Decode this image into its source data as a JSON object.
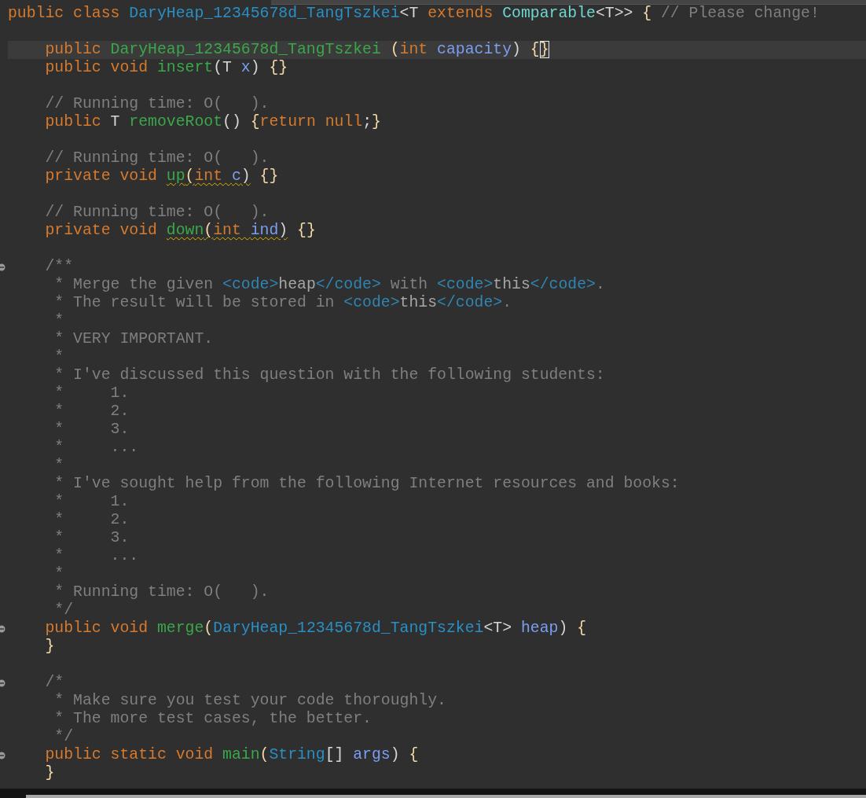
{
  "lines": [
    {
      "fold": false,
      "current": false,
      "tokens": [
        {
          "text": "public class ",
          "kind": "keyword",
          "warning": false,
          "cursor": false
        },
        {
          "text": "DaryHeap_12345678d_TangTszkei",
          "kind": "class",
          "warning": false,
          "cursor": false
        },
        {
          "text": "<T ",
          "kind": "plain",
          "warning": false,
          "cursor": false
        },
        {
          "text": "extends ",
          "kind": "keyword",
          "warning": false,
          "cursor": false
        },
        {
          "text": "Comparable",
          "kind": "type",
          "warning": false,
          "cursor": false
        },
        {
          "text": "<T>> ",
          "kind": "plain",
          "warning": false,
          "cursor": false
        },
        {
          "text": "{ ",
          "kind": "brace",
          "warning": false,
          "cursor": false
        },
        {
          "text": "// Please change!",
          "kind": "comment",
          "warning": false,
          "cursor": false
        }
      ]
    },
    {
      "fold": false,
      "current": false
    },
    {
      "fold": false,
      "current": true,
      "tokens": [
        {
          "text": "    public ",
          "kind": "keyword",
          "warning": false,
          "cursor": false
        },
        {
          "text": "DaryHeap_12345678d_TangTszkei ",
          "kind": "method",
          "warning": false,
          "cursor": false
        },
        {
          "text": "(",
          "kind": "brace",
          "warning": false,
          "cursor": false
        },
        {
          "text": "int ",
          "kind": "keyword",
          "warning": false,
          "cursor": false
        },
        {
          "text": "capacity",
          "kind": "param",
          "warning": false,
          "cursor": false
        },
        {
          "text": ") ",
          "kind": "plain",
          "warning": false,
          "cursor": false
        },
        {
          "text": "{",
          "kind": "brace",
          "warning": false,
          "cursor": false
        },
        {
          "text": "}",
          "kind": "brace",
          "warning": false,
          "cursor": true
        }
      ]
    },
    {
      "fold": false,
      "current": false,
      "tokens": [
        {
          "text": "    public void ",
          "kind": "keyword",
          "warning": false,
          "cursor": false
        },
        {
          "text": "insert",
          "kind": "method",
          "warning": false,
          "cursor": false
        },
        {
          "text": "(T ",
          "kind": "plain",
          "warning": false,
          "cursor": false
        },
        {
          "text": "x",
          "kind": "param",
          "warning": false,
          "cursor": false
        },
        {
          "text": ") ",
          "kind": "plain",
          "warning": false,
          "cursor": false
        },
        {
          "text": "{}",
          "kind": "brace",
          "warning": false,
          "cursor": false
        }
      ]
    },
    {
      "fold": false,
      "current": false
    },
    {
      "fold": false,
      "current": false,
      "tokens": [
        {
          "text": "    // Running time: O(   ).",
          "kind": "comment",
          "warning": false,
          "cursor": false
        }
      ]
    },
    {
      "fold": false,
      "current": false,
      "tokens": [
        {
          "text": "    public ",
          "kind": "keyword",
          "warning": false,
          "cursor": false
        },
        {
          "text": "T ",
          "kind": "plain",
          "warning": false,
          "cursor": false
        },
        {
          "text": "removeRoot",
          "kind": "method",
          "warning": false,
          "cursor": false
        },
        {
          "text": "() ",
          "kind": "plain",
          "warning": false,
          "cursor": false
        },
        {
          "text": "{",
          "kind": "brace",
          "warning": false,
          "cursor": false
        },
        {
          "text": "return null",
          "kind": "keyword",
          "warning": false,
          "cursor": false
        },
        {
          "text": ";",
          "kind": "plain",
          "warning": false,
          "cursor": false
        },
        {
          "text": "}",
          "kind": "brace",
          "warning": false,
          "cursor": false
        }
      ]
    },
    {
      "fold": false,
      "current": false
    },
    {
      "fold": false,
      "current": false,
      "tokens": [
        {
          "text": "    // Running time: O(   ).",
          "kind": "comment",
          "warning": false,
          "cursor": false
        }
      ]
    },
    {
      "fold": false,
      "current": false,
      "tokens": [
        {
          "text": "    private void ",
          "kind": "keyword",
          "warning": false,
          "cursor": false
        },
        {
          "text": "up",
          "kind": "method",
          "warning": true,
          "cursor": false
        },
        {
          "text": "(",
          "kind": "brace",
          "warning": true,
          "cursor": false
        },
        {
          "text": "int ",
          "kind": "keyword",
          "warning": true,
          "cursor": false
        },
        {
          "text": "c",
          "kind": "param",
          "warning": true,
          "cursor": false
        },
        {
          "text": ")",
          "kind": "plain",
          "warning": true,
          "cursor": false
        },
        {
          "text": " {}",
          "kind": "brace",
          "warning": false,
          "cursor": false
        }
      ]
    },
    {
      "fold": false,
      "current": false
    },
    {
      "fold": false,
      "current": false,
      "tokens": [
        {
          "text": "    // Running time: O(   ).",
          "kind": "comment",
          "warning": false,
          "cursor": false
        }
      ]
    },
    {
      "fold": false,
      "current": false,
      "tokens": [
        {
          "text": "    private void ",
          "kind": "keyword",
          "warning": false,
          "cursor": false
        },
        {
          "text": "down",
          "kind": "method",
          "warning": true,
          "cursor": false
        },
        {
          "text": "(",
          "kind": "brace",
          "warning": true,
          "cursor": false
        },
        {
          "text": "int ",
          "kind": "keyword",
          "warning": true,
          "cursor": false
        },
        {
          "text": "ind",
          "kind": "param",
          "warning": true,
          "cursor": false
        },
        {
          "text": ")",
          "kind": "plain",
          "warning": true,
          "cursor": false
        },
        {
          "text": " {}",
          "kind": "brace",
          "warning": false,
          "cursor": false
        }
      ]
    },
    {
      "fold": false,
      "current": false
    },
    {
      "fold": true,
      "current": false,
      "tokens": [
        {
          "text": "    /**",
          "kind": "comment",
          "warning": false,
          "cursor": false
        }
      ]
    },
    {
      "fold": false,
      "current": false,
      "tokens": [
        {
          "text": "     * Merge the given ",
          "kind": "comment",
          "warning": false,
          "cursor": false
        },
        {
          "text": "<code>",
          "kind": "tag",
          "warning": false,
          "cursor": false
        },
        {
          "text": "heap",
          "kind": "doctext",
          "warning": false,
          "cursor": false
        },
        {
          "text": "</code>",
          "kind": "tag",
          "warning": false,
          "cursor": false
        },
        {
          "text": " with ",
          "kind": "comment",
          "warning": false,
          "cursor": false
        },
        {
          "text": "<code>",
          "kind": "tag",
          "warning": false,
          "cursor": false
        },
        {
          "text": "this",
          "kind": "doctext",
          "warning": false,
          "cursor": false
        },
        {
          "text": "</code>",
          "kind": "tag",
          "warning": false,
          "cursor": false
        },
        {
          "text": ".",
          "kind": "comment",
          "warning": false,
          "cursor": false
        }
      ]
    },
    {
      "fold": false,
      "current": false,
      "tokens": [
        {
          "text": "     * The result will be stored in ",
          "kind": "comment",
          "warning": false,
          "cursor": false
        },
        {
          "text": "<code>",
          "kind": "tag",
          "warning": false,
          "cursor": false
        },
        {
          "text": "this",
          "kind": "doctext",
          "warning": false,
          "cursor": false
        },
        {
          "text": "</code>",
          "kind": "tag",
          "warning": false,
          "cursor": false
        },
        {
          "text": ".",
          "kind": "comment",
          "warning": false,
          "cursor": false
        }
      ]
    },
    {
      "fold": false,
      "current": false,
      "tokens": [
        {
          "text": "     *",
          "kind": "comment",
          "warning": false,
          "cursor": false
        }
      ]
    },
    {
      "fold": false,
      "current": false,
      "tokens": [
        {
          "text": "     * VERY IMPORTANT.",
          "kind": "comment",
          "warning": false,
          "cursor": false
        }
      ]
    },
    {
      "fold": false,
      "current": false,
      "tokens": [
        {
          "text": "     *",
          "kind": "comment",
          "warning": false,
          "cursor": false
        }
      ]
    },
    {
      "fold": false,
      "current": false,
      "tokens": [
        {
          "text": "     * I've discussed this question with the following students:",
          "kind": "comment",
          "warning": false,
          "cursor": false
        }
      ]
    },
    {
      "fold": false,
      "current": false,
      "tokens": [
        {
          "text": "     *     1.",
          "kind": "comment",
          "warning": false,
          "cursor": false
        }
      ]
    },
    {
      "fold": false,
      "current": false,
      "tokens": [
        {
          "text": "     *     2.",
          "kind": "comment",
          "warning": false,
          "cursor": false
        }
      ]
    },
    {
      "fold": false,
      "current": false,
      "tokens": [
        {
          "text": "     *     3.",
          "kind": "comment",
          "warning": false,
          "cursor": false
        }
      ]
    },
    {
      "fold": false,
      "current": false,
      "tokens": [
        {
          "text": "     *     ...",
          "kind": "comment",
          "warning": false,
          "cursor": false
        }
      ]
    },
    {
      "fold": false,
      "current": false,
      "tokens": [
        {
          "text": "     *",
          "kind": "comment",
          "warning": false,
          "cursor": false
        }
      ]
    },
    {
      "fold": false,
      "current": false,
      "tokens": [
        {
          "text": "     * I've sought help from the following Internet resources and books:",
          "kind": "comment",
          "warning": false,
          "cursor": false
        }
      ]
    },
    {
      "fold": false,
      "current": false,
      "tokens": [
        {
          "text": "     *     1.",
          "kind": "comment",
          "warning": false,
          "cursor": false
        }
      ]
    },
    {
      "fold": false,
      "current": false,
      "tokens": [
        {
          "text": "     *     2.",
          "kind": "comment",
          "warning": false,
          "cursor": false
        }
      ]
    },
    {
      "fold": false,
      "current": false,
      "tokens": [
        {
          "text": "     *     3.",
          "kind": "comment",
          "warning": false,
          "cursor": false
        }
      ]
    },
    {
      "fold": false,
      "current": false,
      "tokens": [
        {
          "text": "     *     ...",
          "kind": "comment",
          "warning": false,
          "cursor": false
        }
      ]
    },
    {
      "fold": false,
      "current": false,
      "tokens": [
        {
          "text": "     *",
          "kind": "comment",
          "warning": false,
          "cursor": false
        }
      ]
    },
    {
      "fold": false,
      "current": false,
      "tokens": [
        {
          "text": "     * Running time: O(   ).",
          "kind": "comment",
          "warning": false,
          "cursor": false
        }
      ]
    },
    {
      "fold": false,
      "current": false,
      "tokens": [
        {
          "text": "     */",
          "kind": "comment",
          "warning": false,
          "cursor": false
        }
      ]
    },
    {
      "fold": true,
      "current": false,
      "tokens": [
        {
          "text": "    public void ",
          "kind": "keyword",
          "warning": false,
          "cursor": false
        },
        {
          "text": "merge",
          "kind": "method",
          "warning": false,
          "cursor": false
        },
        {
          "text": "(",
          "kind": "brace",
          "warning": false,
          "cursor": false
        },
        {
          "text": "DaryHeap_12345678d_TangTszkei",
          "kind": "class",
          "warning": false,
          "cursor": false
        },
        {
          "text": "<T> ",
          "kind": "plain",
          "warning": false,
          "cursor": false
        },
        {
          "text": "heap",
          "kind": "param",
          "warning": false,
          "cursor": false
        },
        {
          "text": ") ",
          "kind": "plain",
          "warning": false,
          "cursor": false
        },
        {
          "text": "{",
          "kind": "brace",
          "warning": false,
          "cursor": false
        }
      ]
    },
    {
      "fold": false,
      "current": false,
      "tokens": [
        {
          "text": "    }",
          "kind": "brace",
          "warning": false,
          "cursor": false
        }
      ]
    },
    {
      "fold": false,
      "current": false
    },
    {
      "fold": true,
      "current": false,
      "tokens": [
        {
          "text": "    /*",
          "kind": "comment",
          "warning": false,
          "cursor": false
        }
      ]
    },
    {
      "fold": false,
      "current": false,
      "tokens": [
        {
          "text": "     * Make sure you test your code thoroughly.",
          "kind": "comment",
          "warning": false,
          "cursor": false
        }
      ]
    },
    {
      "fold": false,
      "current": false,
      "tokens": [
        {
          "text": "     * The more test cases, the better.",
          "kind": "comment",
          "warning": false,
          "cursor": false
        }
      ]
    },
    {
      "fold": false,
      "current": false,
      "tokens": [
        {
          "text": "     */",
          "kind": "comment",
          "warning": false,
          "cursor": false
        }
      ]
    },
    {
      "fold": true,
      "current": false,
      "tokens": [
        {
          "text": "    public static void ",
          "kind": "keyword",
          "warning": false,
          "cursor": false
        },
        {
          "text": "main",
          "kind": "method",
          "warning": false,
          "cursor": false
        },
        {
          "text": "(",
          "kind": "brace",
          "warning": false,
          "cursor": false
        },
        {
          "text": "String",
          "kind": "class",
          "warning": false,
          "cursor": false
        },
        {
          "text": "[] ",
          "kind": "plain",
          "warning": false,
          "cursor": false
        },
        {
          "text": "args",
          "kind": "param",
          "warning": false,
          "cursor": false
        },
        {
          "text": ") ",
          "kind": "plain",
          "warning": false,
          "cursor": false
        },
        {
          "text": "{",
          "kind": "brace",
          "warning": false,
          "cursor": false
        }
      ]
    },
    {
      "fold": false,
      "current": false,
      "tokens": [
        {
          "text": "    }",
          "kind": "brace",
          "warning": false,
          "cursor": false
        }
      ]
    }
  ]
}
